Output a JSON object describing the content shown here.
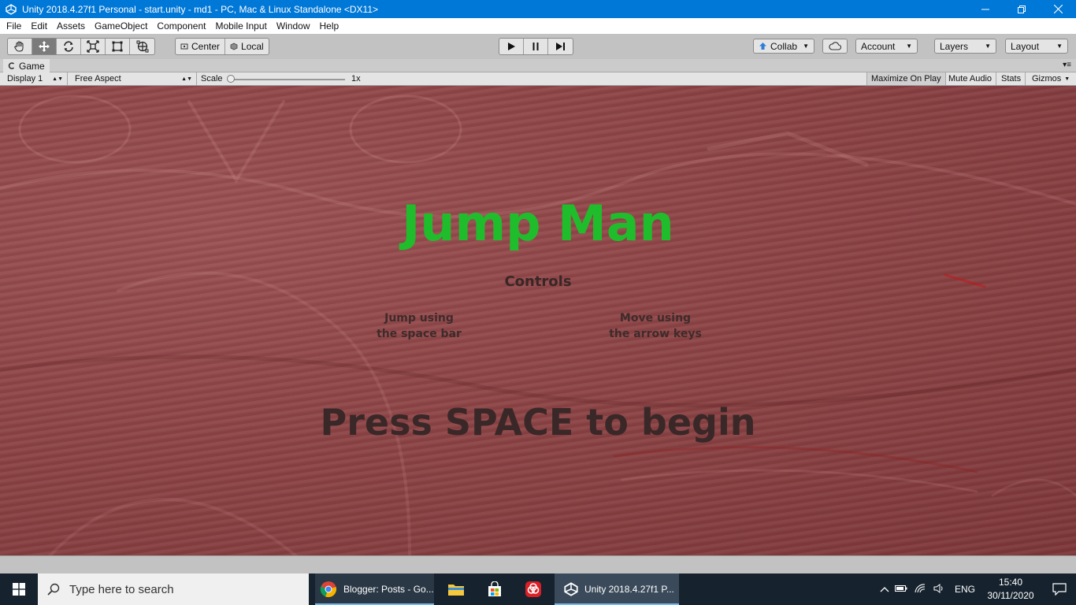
{
  "window": {
    "title": "Unity 2018.4.27f1 Personal - start.unity - md1 - PC, Mac & Linux Standalone <DX11>"
  },
  "menu": [
    "File",
    "Edit",
    "Assets",
    "GameObject",
    "Component",
    "Mobile Input",
    "Window",
    "Help"
  ],
  "toolbar": {
    "pivot_label": "Center",
    "space_label": "Local",
    "collab_label": "Collab",
    "account_label": "Account",
    "layers_label": "Layers",
    "layout_label": "Layout"
  },
  "game_tab": {
    "label": "Game"
  },
  "game_toolbar": {
    "display": "Display 1",
    "aspect": "Free Aspect",
    "scale_label": "Scale",
    "scale_value": "1x",
    "maximize_on_play": "Maximize On Play",
    "mute_audio": "Mute Audio",
    "stats": "Stats",
    "gizmos": "Gizmos"
  },
  "game_screen": {
    "title": "Jump Man",
    "controls_heading": "Controls",
    "jump_hint_line1": "Jump using",
    "jump_hint_line2": "the space bar",
    "move_hint_line1": "Move using",
    "move_hint_line2": "the arrow keys",
    "start_prompt": "Press SPACE to begin"
  },
  "taskbar": {
    "search_placeholder": "Type here to search",
    "chrome_label": "Blogger: Posts - Go...",
    "unity_label": "Unity 2018.4.27f1 P...",
    "language": "ENG",
    "time": "15:40",
    "date": "30/11/2020"
  },
  "colors": {
    "titlebar": "#0078d7",
    "game_title": "#1fbd2b",
    "game_background": "#8c4345",
    "taskbar": "#16232f"
  }
}
